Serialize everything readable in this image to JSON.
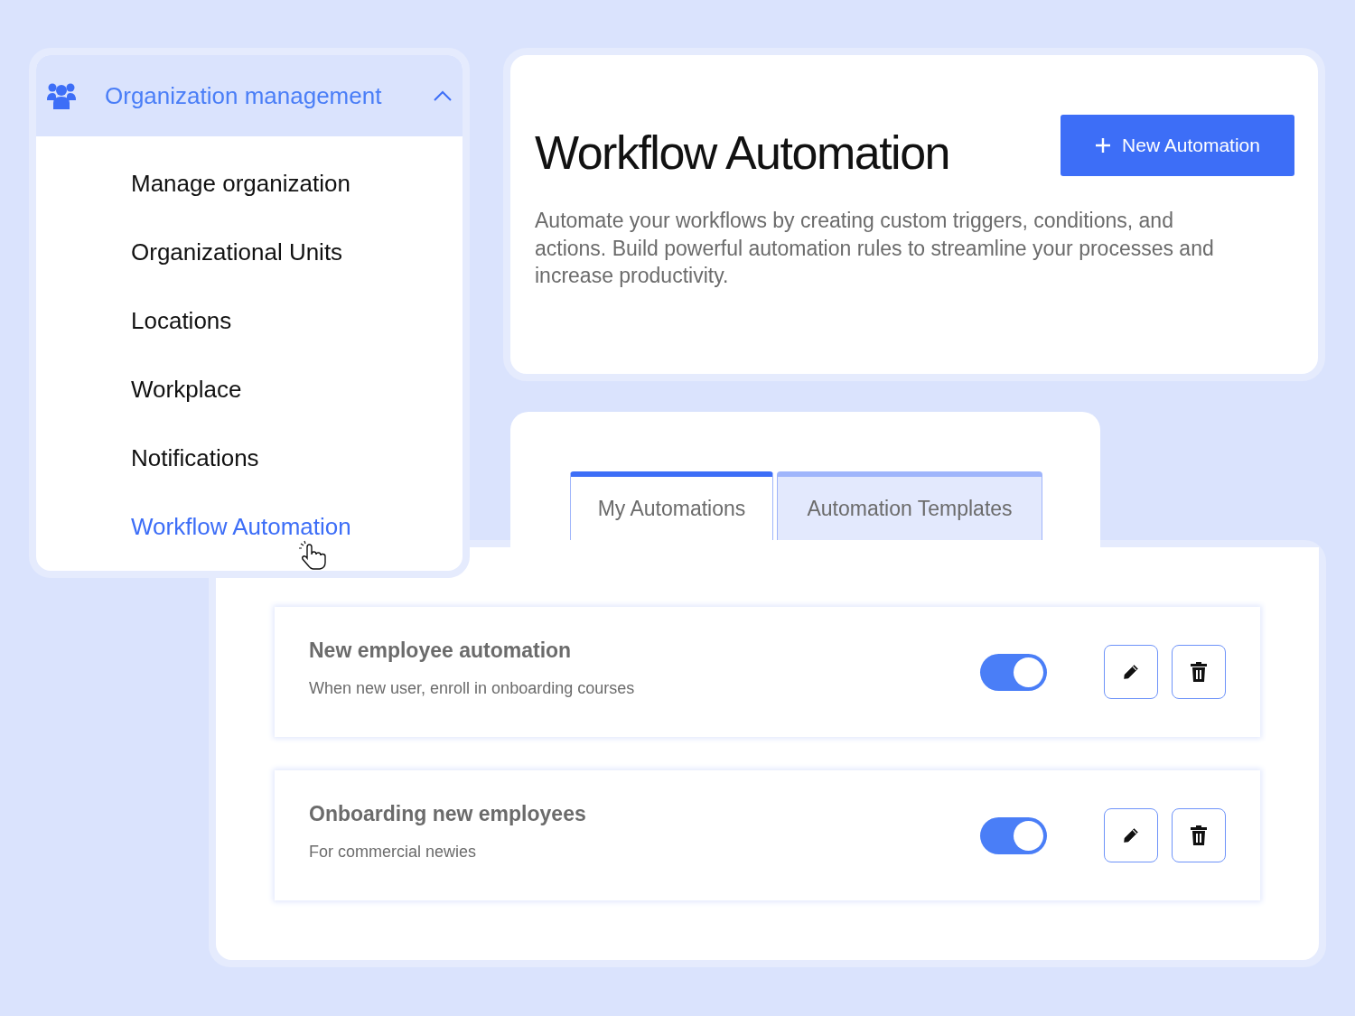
{
  "menu": {
    "title": "Organization management",
    "expanded": true,
    "items": [
      {
        "label": "Manage organization",
        "selected": false
      },
      {
        "label": "Organizational Units",
        "selected": false
      },
      {
        "label": "Locations",
        "selected": false
      },
      {
        "label": "Workplace",
        "selected": false
      },
      {
        "label": "Notifications",
        "selected": false
      },
      {
        "label": "Workflow Automation",
        "selected": true
      }
    ]
  },
  "header": {
    "title": "Workflow Automation",
    "button": "New Automation",
    "description": "Automate your workflows by creating custom triggers, conditions, and actions. Build powerful automation rules to streamline your processes and increase productivity."
  },
  "tabs": [
    {
      "label": "My Automations",
      "selected": true
    },
    {
      "label": "Automation Templates",
      "selected": false
    }
  ],
  "automations": [
    {
      "name": "New employee automation",
      "description": "When new user, enroll in onboarding courses",
      "on": true
    },
    {
      "name": "Onboarding new employees",
      "description": "For commercial newies",
      "on": true
    }
  ]
}
